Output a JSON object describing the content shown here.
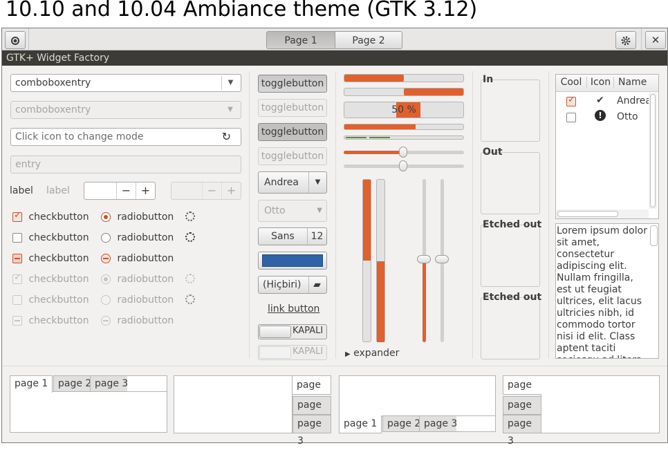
{
  "heading": "10.10 and 10.04 Ambiance theme (GTK 3.12)",
  "header": {
    "page_tabs": [
      "Page 1",
      "Page 2"
    ],
    "settings_icon": "gear-icon",
    "close_icon": "close-icon",
    "close_glyph": "✕"
  },
  "window": {
    "title": "GTK+ Widget Factory"
  },
  "col1": {
    "combo_entry": "comboboxentry",
    "combo_entry_disabled": "comboboxentry",
    "icon_entry_placeholder": "Click icon to change mode",
    "entry_disabled_placeholder": "entry",
    "label": "label",
    "label_disabled": "label",
    "spin_minus": "−",
    "spin_plus": "+",
    "checkbuttons": [
      "checkbutton",
      "checkbutton",
      "checkbutton",
      "checkbutton",
      "checkbutton",
      "checkbutton"
    ],
    "radiobuttons": [
      "radiobutton",
      "radiobutton",
      "radiobutton",
      "radiobutton",
      "radiobutton",
      "radiobutton"
    ]
  },
  "col2": {
    "toggles": [
      "togglebutton",
      "togglebutton",
      "togglebutton",
      "togglebutton"
    ],
    "combo_andrea": "Andrea",
    "combo_otto": "Otto",
    "font_name": "Sans",
    "font_size": "12",
    "color_value": "#2f63a5",
    "file_button": "(Hiçbiri)",
    "link": "link button",
    "switch_off": "KAPALI",
    "switch_off_disabled": "KAPALI"
  },
  "col3": {
    "progress": [
      0.5,
      0.5
    ],
    "progress_text": "50 %",
    "level_bar": 0.6,
    "scale_value": 0.5,
    "vertical_levels": [
      0.35,
      0.6
    ],
    "vertical_scales": [
      0.45,
      0.45
    ],
    "expander": "expander"
  },
  "col4": {
    "frames": [
      "In",
      "Out",
      "Etched out",
      "Etched out"
    ]
  },
  "col5": {
    "tree_headers": [
      "Cool",
      "Icon",
      "Name"
    ],
    "tree_rows": [
      {
        "cool": true,
        "name": "Andrea"
      },
      {
        "cool": false,
        "name": "Otto"
      }
    ],
    "textview": "Lorem ipsum dolor sit amet, consectetur adipiscing elit. Nullam fringilla, est ut feugiat ultrices, elit lacus ultricies nibh, id commodo tortor nisi id elit. Class aptent taciti sociosqu ad litora"
  },
  "notebooks": {
    "tabs": [
      "page 1",
      "page 2",
      "page 3"
    ]
  },
  "colors": {
    "accent": "#e0602e",
    "titlebar": "#3c3b37"
  }
}
